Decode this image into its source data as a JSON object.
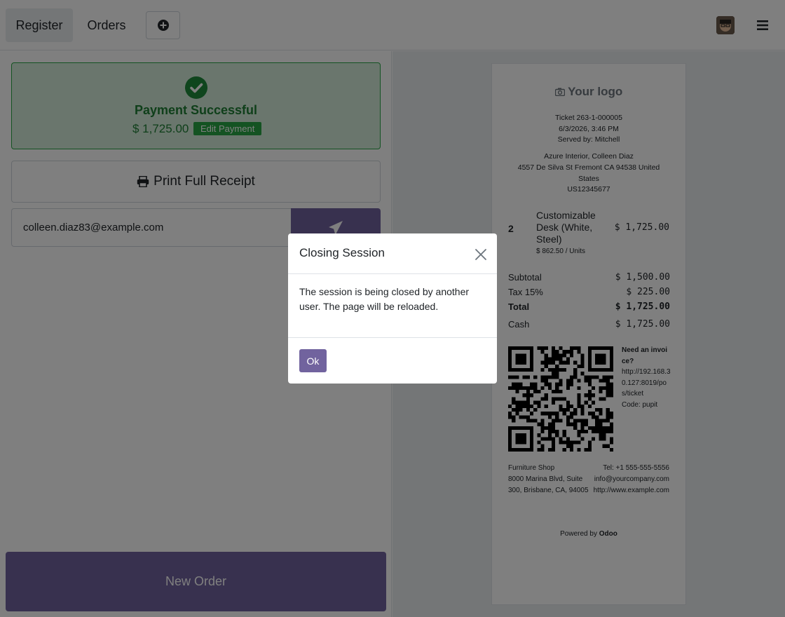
{
  "navbar": {
    "tab_register": "Register",
    "tab_orders": "Orders"
  },
  "payment": {
    "title": "Payment Successful",
    "amount": "$ 1,725.00",
    "edit_label": "Edit Payment",
    "status_color": "#28a745"
  },
  "actions": {
    "print_label": "Print Full Receipt",
    "email_value": "colleen.diaz83@example.com",
    "new_order_label": "New Order",
    "accent_color": "#71639e"
  },
  "receipt": {
    "logo": "Your logo",
    "ticket": "Ticket 263-1-000005",
    "datetime": "6/3/2026, 3:46 PM",
    "served_by": "Served by: Mitchell",
    "customer_name": "Azure Interior, Colleen Diaz",
    "customer_address_1": "4557 De Silva St Fremont CA 94538 United",
    "customer_address_2": "States",
    "customer_vat": "US12345677",
    "line": {
      "qty": "2",
      "product": "Customizable Desk (White, Steel)",
      "unit_price": "$ 862.50 / Units",
      "price": "$ 1,725.00"
    },
    "subtotal_label": "Subtotal",
    "subtotal_value": "$ 1,500.00",
    "tax_label": "Tax 15%",
    "tax_value": "$ 225.00",
    "total_label": "Total",
    "total_value": "$ 1,725.00",
    "cash_label": "Cash",
    "cash_value": "$ 1,725.00",
    "invoice_title": "Need an invoice?",
    "invoice_url": "http://192.168.30.127:8019/pos/ticket",
    "invoice_code": "Code: pupit",
    "company_name": "Furniture Shop",
    "company_address": "8000 Marina Blvd, Suite 300, Brisbane, CA, 94005",
    "company_tel": "Tel: +1 555-555-5556",
    "company_email": "info@yourcompany.com",
    "company_web": "http://www.example.com",
    "powered_prefix": "Powered by",
    "powered_brand": "Odoo"
  },
  "modal": {
    "title": "Closing Session",
    "body": "The session is being closed by another user. The page will be reloaded.",
    "ok_label": "Ok"
  },
  "icons": {
    "add": "plus-circle-icon",
    "menu": "hamburger-icon",
    "check": "check-circle-icon",
    "print": "printer-icon",
    "send": "paper-plane-icon",
    "close": "close-icon"
  }
}
